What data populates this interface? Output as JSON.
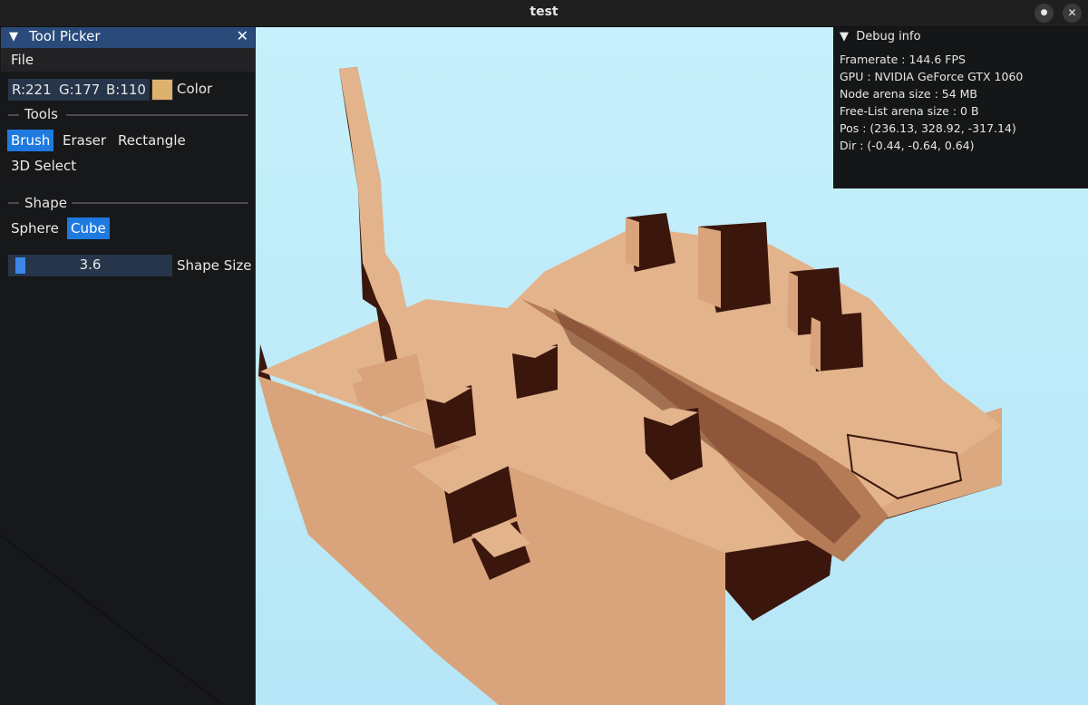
{
  "window": {
    "title": "test",
    "minimize_glyph": "●",
    "close_glyph": "✕"
  },
  "tool_picker": {
    "title": "Tool Picker",
    "collapse_glyph": "▼",
    "close_glyph": "✕",
    "menu": {
      "file": "File"
    },
    "color": {
      "r": "R:221",
      "g": "G:177",
      "b": "B:110",
      "label": "Color",
      "swatch": "#ddb16e"
    },
    "tools": {
      "header": "Tools",
      "brush": "Brush",
      "eraser": "Eraser",
      "rectangle": "Rectangle",
      "select3d": "3D Select",
      "active": "Brush"
    },
    "shape": {
      "header": "Shape",
      "sphere": "Sphere",
      "cube": "Cube",
      "active": "Cube"
    },
    "shape_size": {
      "value": "3.6",
      "label": "Shape Size"
    }
  },
  "debug": {
    "title": "Debug info",
    "collapse_glyph": "▼",
    "framerate": "Framerate : 144.6 FPS",
    "gpu": "GPU : NVIDIA GeForce GTX 1060",
    "node_arena": "Node arena size : 54 MB",
    "free_list": "Free-List arena size : 0 B",
    "pos": "Pos : (236.13, 328.92, -317.14)",
    "dir": "Dir : (-0.44, -0.64, 0.64)"
  },
  "colors": {
    "sky": "#c3effb",
    "sand_top": "#e3b48c",
    "sand_shadow": "#3a140c",
    "accent": "#1f7ae0"
  }
}
